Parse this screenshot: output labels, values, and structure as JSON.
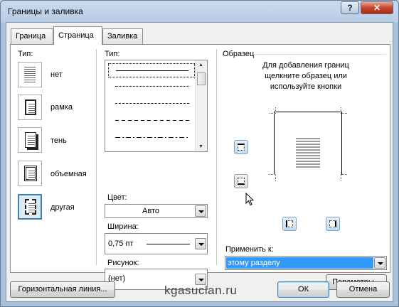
{
  "window": {
    "title": "Границы и заливка"
  },
  "tabs": [
    {
      "label": "Граница"
    },
    {
      "label": "Страница"
    },
    {
      "label": "Заливка"
    }
  ],
  "settings": {
    "type_label": "Тип:",
    "items": [
      {
        "label": "нет"
      },
      {
        "label": "рамка"
      },
      {
        "label": "тень"
      },
      {
        "label": "объемная"
      },
      {
        "label": "другая"
      }
    ]
  },
  "style": {
    "type_label": "Тип:",
    "color_label": "Цвет:",
    "color_value": "Авто",
    "width_label": "Ширина:",
    "width_value": "0,75 пт",
    "art_label": "Рисунок:",
    "art_value": "(нет)"
  },
  "preview": {
    "label": "Образец",
    "hint_line1": "Для добавления границ",
    "hint_line2": "щелкните образец или",
    "hint_line3": "используйте кнопки",
    "apply_label": "Применить к:",
    "apply_value": "этому разделу",
    "options_button": "Параметры..."
  },
  "footer": {
    "horizontal_line_button": "Горизонтальная линия...",
    "ok_button": "ОК",
    "cancel_button": "Отмена"
  },
  "watermark": "kgasuclan.ru",
  "colors": {
    "accent": "#3399ff",
    "selection": "#3c7fb1",
    "close": "#c7452c"
  }
}
